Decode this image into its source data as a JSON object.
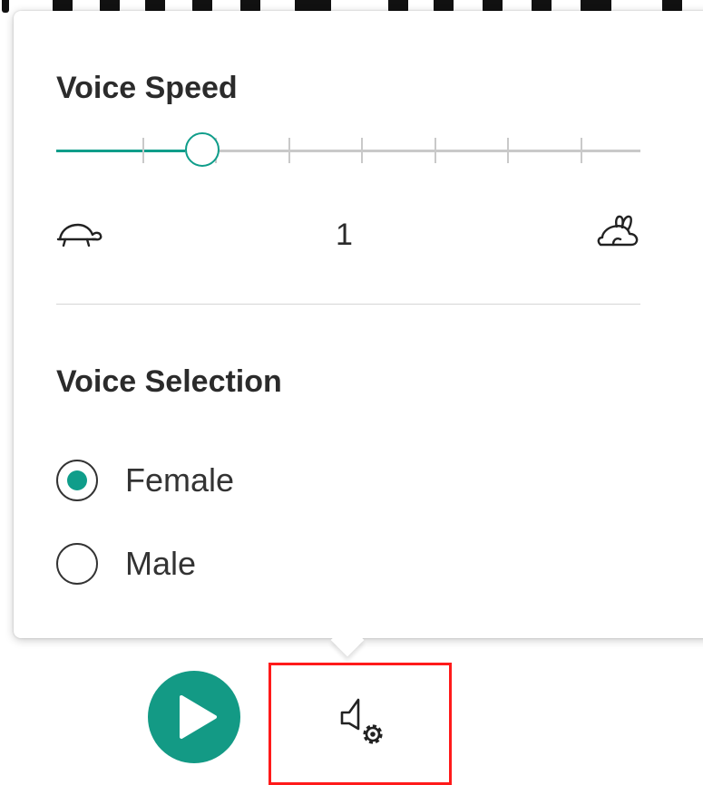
{
  "colors": {
    "accent": "#139a85",
    "highlight_border": "#ff1a1a"
  },
  "voice_speed": {
    "title": "Voice Speed",
    "value": "1",
    "slider_level_fraction": 0.25,
    "tick_count": 8,
    "slow_icon": "turtle-icon",
    "fast_icon": "rabbit-icon"
  },
  "voice_selection": {
    "title": "Voice Selection",
    "options": [
      {
        "label": "Female",
        "selected": true
      },
      {
        "label": "Male",
        "selected": false
      }
    ]
  },
  "controls": {
    "play_icon": "play-icon",
    "voice_settings_icon": "speaker-gear-icon"
  }
}
